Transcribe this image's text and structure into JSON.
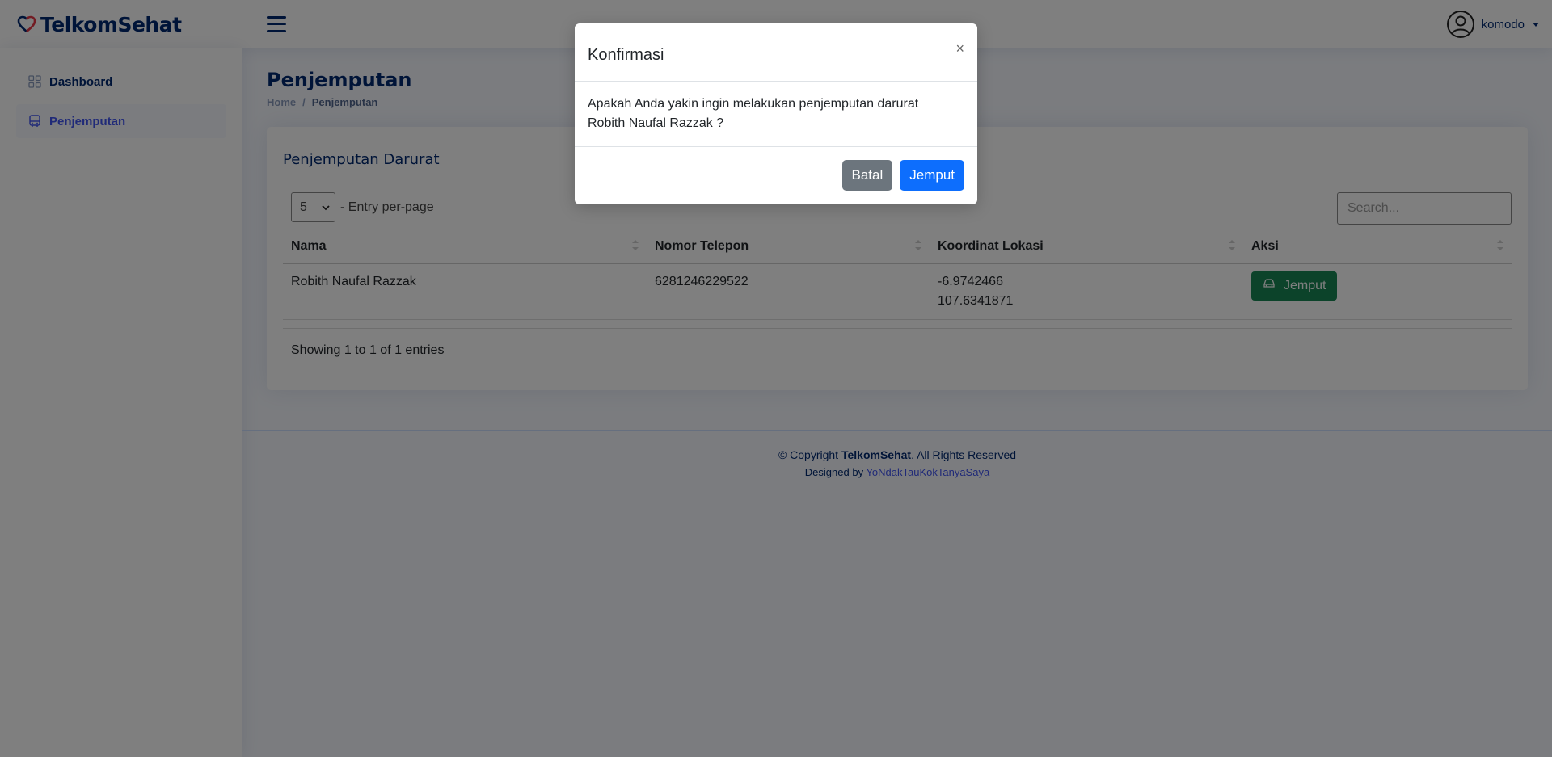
{
  "header": {
    "brand": "TelkomSehat",
    "user_name": "komodo"
  },
  "sidebar": {
    "items": [
      {
        "label": "Dashboard",
        "icon": "grid-icon"
      },
      {
        "label": "Penjemputan",
        "icon": "bus-icon",
        "active": true
      }
    ]
  },
  "page": {
    "title": "Penjemputan",
    "breadcrumb": [
      "Home",
      "Penjemputan"
    ]
  },
  "card": {
    "title": "Penjemputan Darurat",
    "per_page_value": "5",
    "per_page_label": "- Entry per-page",
    "search_placeholder": "Search...",
    "columns": [
      "Nama",
      "Nomor Telepon",
      "Koordinat Lokasi",
      "Aksi"
    ],
    "rows": [
      {
        "nama": "Robith Naufal Razzak",
        "telepon": "6281246229522",
        "lat": "-6.9742466",
        "lng": "107.6341871",
        "action": "Jemput"
      }
    ],
    "showing": "Showing 1 to 1 of 1 entries"
  },
  "footer": {
    "copyright_prefix": "© Copyright ",
    "copyright_brand": "TelkomSehat",
    "copyright_suffix": ". All Rights Reserved",
    "designed_prefix": "Designed by ",
    "designed_by": "YoNdakTauKokTanyaSaya"
  },
  "modal": {
    "title": "Konfirmasi",
    "close": "×",
    "body_line1": "Apakah Anda yakin ingin melakukan penjemputan darurat",
    "body_line2": "Robith Naufal Razzak ?",
    "cancel_label": "Batal",
    "confirm_label": "Jemput"
  },
  "colors": {
    "brand": "#012970",
    "accent": "#4154f1",
    "success": "#198754",
    "primary": "#0d6efd",
    "secondary": "#6c757d"
  }
}
